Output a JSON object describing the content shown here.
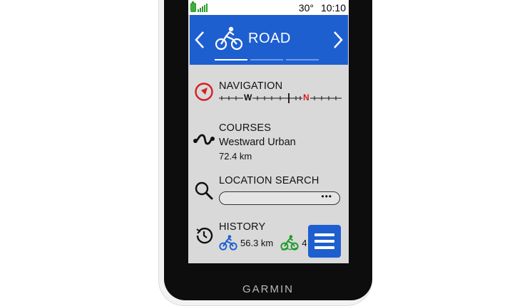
{
  "status": {
    "temperature": "30°",
    "time": "10:10"
  },
  "header": {
    "profile_label": "ROAD",
    "profile_icon": "bike-icon"
  },
  "navigation": {
    "title": "NAVIGATION",
    "compass": {
      "west_label": "W",
      "north_label": "N"
    },
    "accent_color": "#d42020"
  },
  "courses": {
    "title": "COURSES",
    "course_name": "Westward Urban",
    "distance": "72.4 km"
  },
  "location_search": {
    "title": "LOCATION SEARCH",
    "dots": "•••"
  },
  "history": {
    "title": "HISTORY",
    "road_distance": "56.3 km",
    "second_partial": "4"
  },
  "brand": "GARMIN",
  "colors": {
    "header_blue": "#1e5fd0",
    "ride_blue": "#1e5fd0",
    "ride_green": "#1f9a2a"
  }
}
